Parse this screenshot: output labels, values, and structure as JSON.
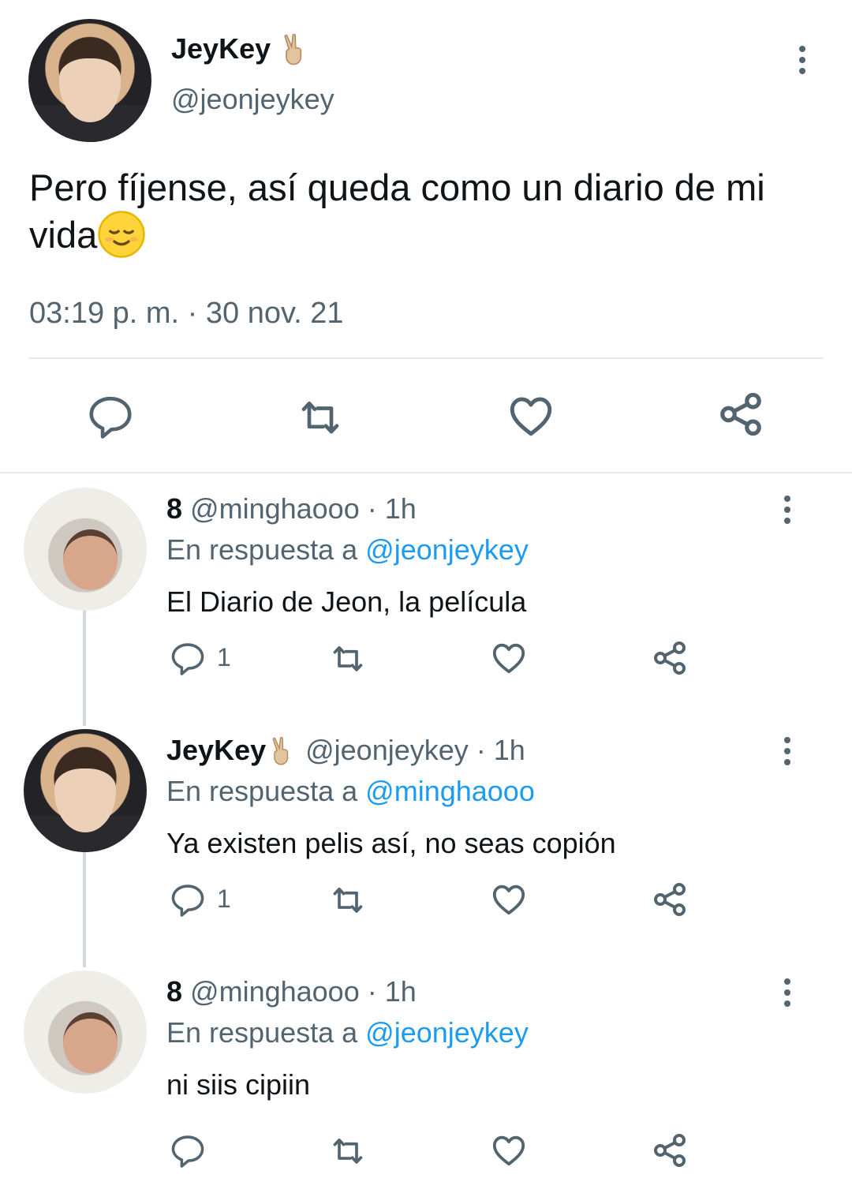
{
  "main_tweet": {
    "name": "JeyKey",
    "name_emoji": "victory-hand-icon",
    "handle": "@jeonjeykey",
    "text": "Pero fíjense, así queda como un diario de mi vida",
    "text_emoji": "relieved-face-icon",
    "timestamp": "03:19 p. m. · 30 nov. 21",
    "actions": [
      "reply-icon",
      "retweet-icon",
      "like-icon",
      "share-icon"
    ]
  },
  "replies": [
    {
      "name": "8",
      "handle": "@minghaooo",
      "time": "· 1h",
      "reply_prefix": "En respuesta a",
      "reply_to": "@jeonjeykey",
      "text": "El Diario de Jeon, la película",
      "reply_count": "1"
    },
    {
      "name": "JeyKey",
      "name_emoji": "victory-hand-icon",
      "handle": "@jeonjeykey",
      "time": "· 1h",
      "reply_prefix": "En respuesta a",
      "reply_to": "@minghaooo",
      "text": "Ya existen pelis así, no seas copión",
      "reply_count": "1"
    },
    {
      "name": "8",
      "handle": "@minghaooo",
      "time": "· 1h",
      "reply_prefix": "En respuesta a",
      "reply_to": "@jeonjeykey",
      "text": "ni siis cipiin",
      "reply_count": ""
    }
  ],
  "colors": {
    "text": "#0f1419",
    "muted": "#536471",
    "link": "#1d9bf0",
    "divider": "#e7eaed"
  }
}
